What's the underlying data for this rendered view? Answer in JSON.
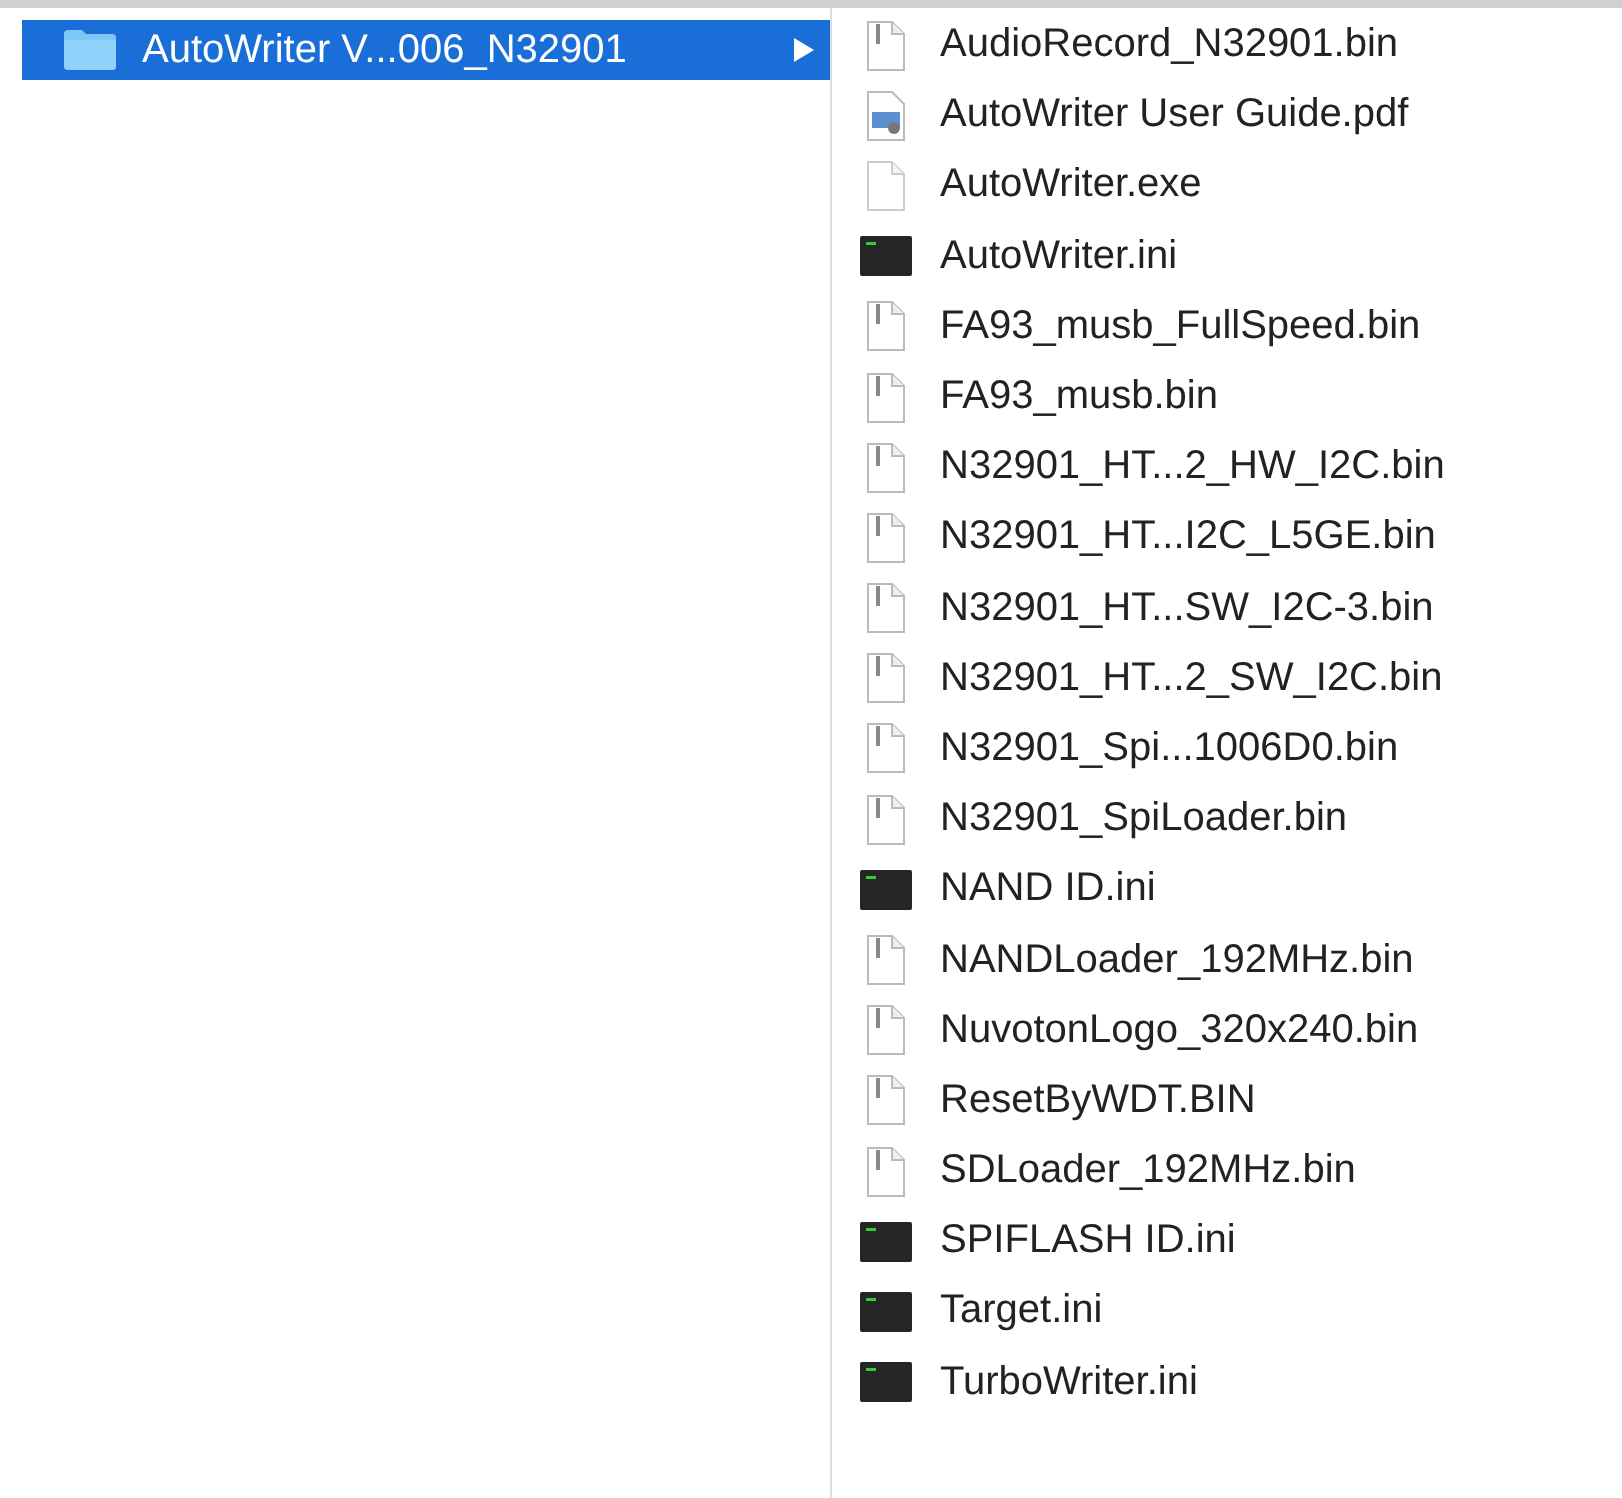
{
  "folder_column": {
    "items": [
      {
        "name": "AutoWriter V...006_N32901",
        "selected": true,
        "has_children": true
      }
    ]
  },
  "files": [
    {
      "name": "AudioRecord_N32901.bin",
      "kind": "archive"
    },
    {
      "name": "AutoWriter User Guide.pdf",
      "kind": "document"
    },
    {
      "name": "AutoWriter.exe",
      "kind": "blank"
    },
    {
      "name": "AutoWriter.ini",
      "kind": "terminal"
    },
    {
      "name": "FA93_musb_FullSpeed.bin",
      "kind": "archive"
    },
    {
      "name": "FA93_musb.bin",
      "kind": "archive"
    },
    {
      "name": "N32901_HT...2_HW_I2C.bin",
      "kind": "archive"
    },
    {
      "name": "N32901_HT...I2C_L5GE.bin",
      "kind": "archive"
    },
    {
      "name": "N32901_HT...SW_I2C-3.bin",
      "kind": "archive"
    },
    {
      "name": "N32901_HT...2_SW_I2C.bin",
      "kind": "archive"
    },
    {
      "name": "N32901_Spi...1006D0.bin",
      "kind": "archive"
    },
    {
      "name": "N32901_SpiLoader.bin",
      "kind": "archive"
    },
    {
      "name": "NAND ID.ini",
      "kind": "terminal"
    },
    {
      "name": "NANDLoader_192MHz.bin",
      "kind": "archive"
    },
    {
      "name": "NuvotonLogo_320x240.bin",
      "kind": "archive"
    },
    {
      "name": "ResetByWDT.BIN",
      "kind": "archive"
    },
    {
      "name": "SDLoader_192MHz.bin",
      "kind": "archive"
    },
    {
      "name": "SPIFLASH ID.ini",
      "kind": "terminal"
    },
    {
      "name": "Target.ini",
      "kind": "terminal"
    },
    {
      "name": "TurboWriter.ini",
      "kind": "terminal"
    }
  ]
}
